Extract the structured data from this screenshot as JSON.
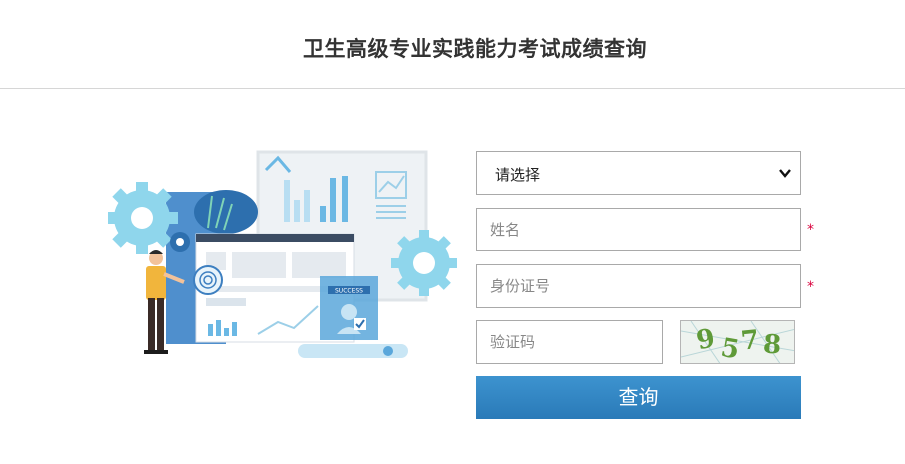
{
  "header": {
    "title": "卫生高级专业实践能力考试成绩查询"
  },
  "form": {
    "select": {
      "value": "请选择"
    },
    "name": {
      "placeholder": "姓名",
      "required_mark": "*"
    },
    "id_number": {
      "placeholder": "身份证号",
      "required_mark": "*"
    },
    "verify_code": {
      "placeholder": "验证码"
    },
    "captcha": {
      "text": "9578"
    },
    "submit_label": "查询"
  },
  "illustration": {
    "badge_text": "SUCCESS"
  },
  "colors": {
    "button": "#2e82c0",
    "required": "#d9003c",
    "accent_light": "#8fd6ec",
    "accent_dark": "#2d6fae"
  }
}
